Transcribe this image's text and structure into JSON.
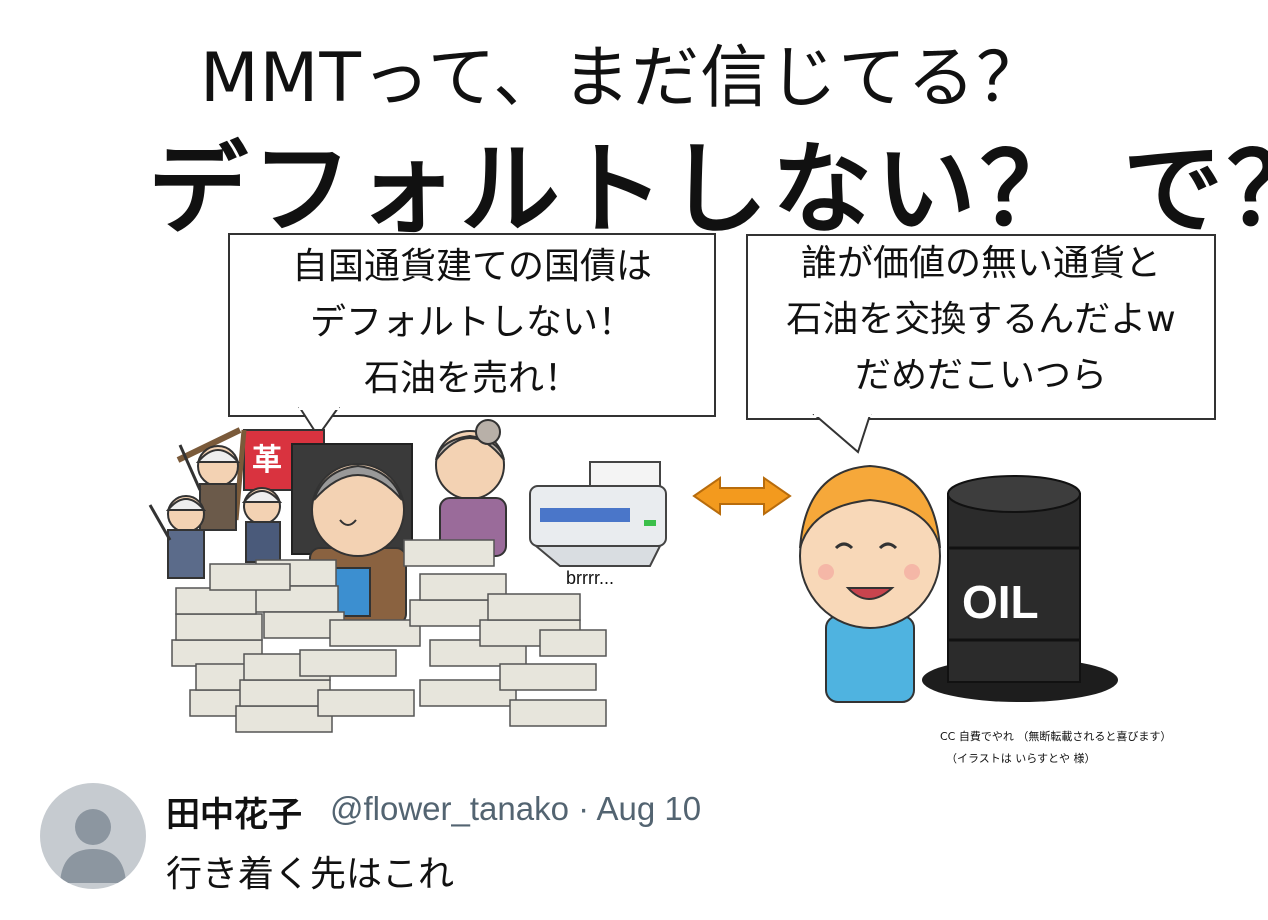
{
  "image": {
    "title_line1": "MMTって、まだ信じてる？",
    "title_line2": "デフォルトしない？ で？",
    "bubble_left": [
      "自国通貨建ての国債は",
      "デフォルトしない！",
      "石油を売れ！"
    ],
    "bubble_right": [
      "誰が価値の無い通貨と",
      "石油を交換するんだよw",
      "だめだこいつら"
    ],
    "flag_text": "革",
    "printer_sound": "brrrr...",
    "oil_label": "OIL",
    "credit_line1": "CC 自費でやれ （無断転載されると喜びます）",
    "credit_line2": "（イラストは いらすとや 様）"
  },
  "tweet": {
    "display_name": "田中花子",
    "handle_date": "@flower_tanako · Aug 10",
    "text": "行き着く先はこれ"
  },
  "colors": {
    "arrow_orange": "#f39a1e",
    "barrel": "#2b2b2b",
    "shirt_blue": "#4fb3e0",
    "hair_orange": "#f6a83a",
    "avatar_bg": "#c6cbd0",
    "handle_gray": "#536471",
    "flag_red": "#d9333f"
  }
}
